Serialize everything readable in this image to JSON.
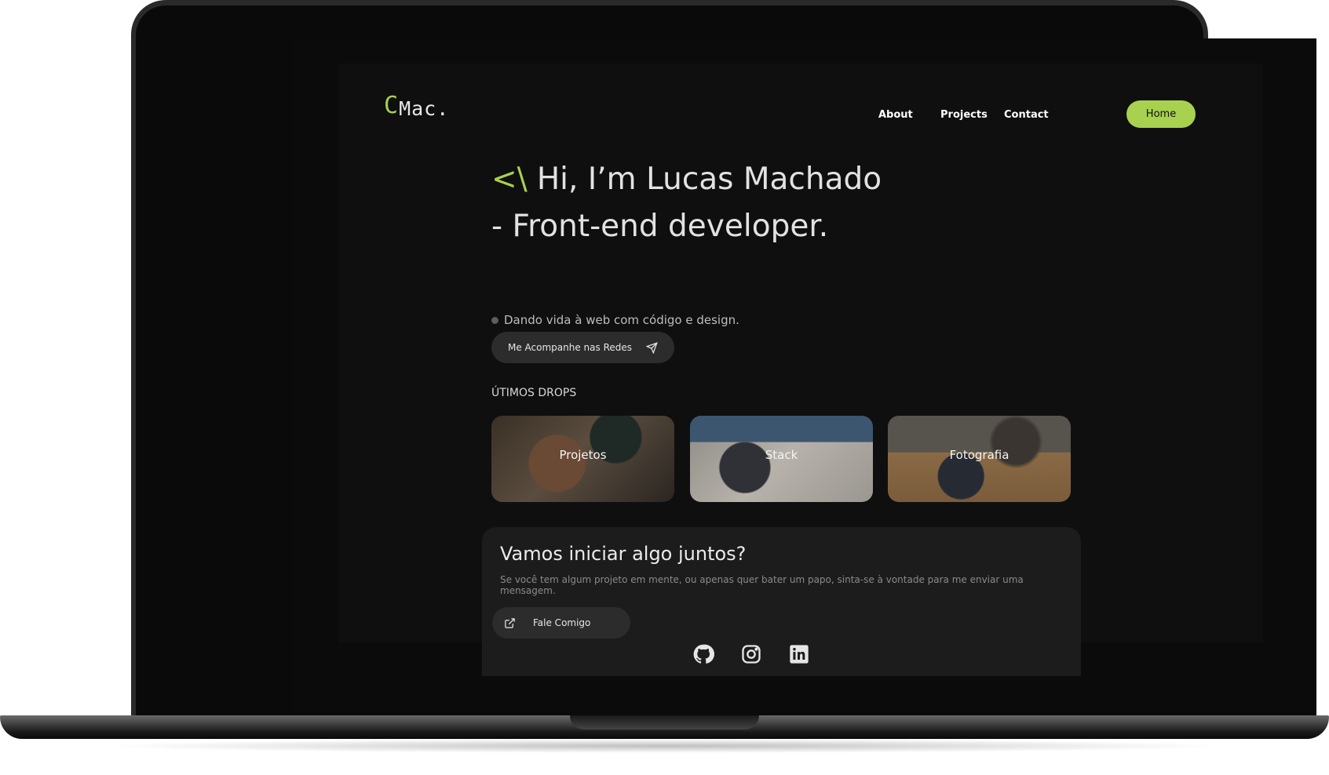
{
  "logo": {
    "accent": "C",
    "text": "Mac."
  },
  "nav": {
    "about": "About",
    "projects": "Projects",
    "contact": "Contact",
    "home": "Home"
  },
  "hero": {
    "code_mark": "<\\",
    "heading": "Hi, I’m Lucas Machado - Front-end developer.",
    "tagline": "Dando vida à web com código e design."
  },
  "follow_button": {
    "label": "Me Acompanhe nas Redes",
    "icon": "send-icon"
  },
  "drops": {
    "title": "ÚTIMOS DROPS",
    "cards": [
      {
        "label": "Projetos"
      },
      {
        "label": "Stack"
      },
      {
        "label": "Fotografia"
      }
    ]
  },
  "cta": {
    "title": "Vamos iniciar algo juntos?",
    "text": "Se você tem algum projeto em mente, ou apenas quer bater um papo, sinta-se à vontade para me enviar uma mensagem.",
    "button": {
      "label": "Fale Comigo",
      "icon": "external-link-icon"
    }
  },
  "socials": [
    "github-icon",
    "instagram-icon",
    "linkedin-icon"
  ],
  "colors": {
    "accent": "#a8d14f",
    "background": "#0f0f0f",
    "card": "#1c1c1c",
    "button": "#2c2c2c"
  }
}
